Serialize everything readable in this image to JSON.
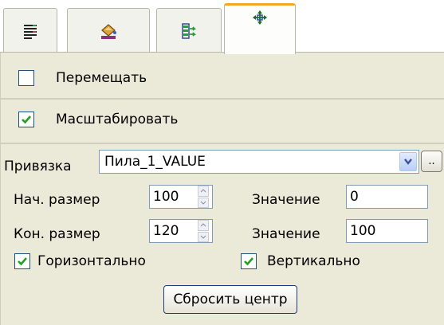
{
  "tabs": [
    {
      "icon": "list-lines-icon"
    },
    {
      "icon": "paint-bucket-icon"
    },
    {
      "icon": "layout-arrows-icon"
    },
    {
      "icon": "move-arrows-icon",
      "active": true
    }
  ],
  "move": {
    "label": "Перемещать",
    "checked": false
  },
  "scale": {
    "label": "Масштабировать",
    "checked": true
  },
  "binding": {
    "label": "Привязка",
    "value": "Пила_1_VALUE",
    "browse_label": ".."
  },
  "start_size": {
    "label": "Нач. размер",
    "value": "100",
    "value_label": "Значение",
    "value_field": "0"
  },
  "end_size": {
    "label": "Кон. размер",
    "value": "120",
    "value_label": "Значение",
    "value_field": "100"
  },
  "horizontal": {
    "label": "Горизонтально",
    "checked": true
  },
  "vertical": {
    "label": "Вертикально",
    "checked": true
  },
  "reset_center": {
    "label": "Сбросить центр"
  },
  "colors": {
    "active_tab_accent": "#f5a623",
    "checkmark": "#21a121",
    "panel_bg": "#ebe9d8"
  }
}
